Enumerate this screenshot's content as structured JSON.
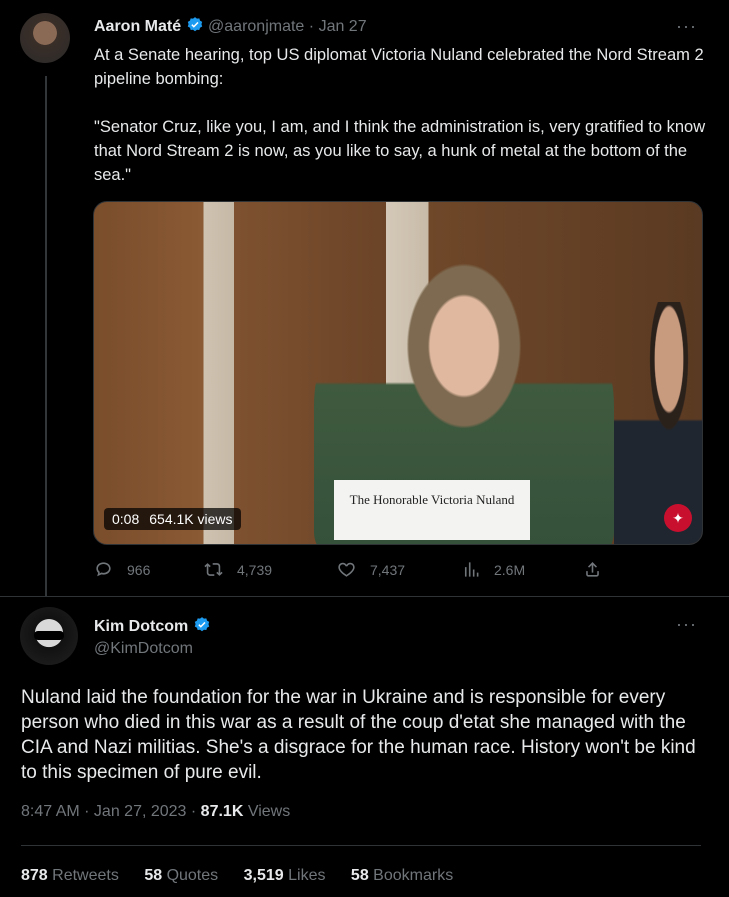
{
  "tweet1": {
    "author": "Aaron Maté",
    "handle": "@aaronjmate",
    "dot": "·",
    "date": "Jan 27",
    "text": "At a Senate hearing, top US diplomat Victoria Nuland celebrated the Nord Stream 2 pipeline bombing:\n\n\"Senator Cruz, like you, I am, and I think the administration is, very gratified to know that Nord Stream 2 is now, as you like to say, a hunk of metal at the bottom of the sea.\"",
    "video": {
      "time": "0:08",
      "views": "654.1K views",
      "placard": "The Honorable Victoria Nuland"
    },
    "actions": {
      "replies": "966",
      "retweets": "4,739",
      "likes": "7,437",
      "views": "2.6M"
    },
    "more": "···"
  },
  "tweet2": {
    "author": "Kim Dotcom",
    "handle": "@KimDotcom",
    "more": "···",
    "text": "Nuland laid the foundation for the war in Ukraine and is responsible for every person who died in this war as a result of the coup d'etat she managed with the CIA and Nazi militias. She's a disgrace for the human race. History won't be kind to this specimen of pure evil.",
    "time": "8:47 AM",
    "date": "Jan 27, 2023",
    "views_count": "87.1K",
    "views_label": "Views",
    "stats": {
      "retweets_count": "878",
      "retweets_label": "Retweets",
      "quotes_count": "58",
      "quotes_label": "Quotes",
      "likes_count": "3,519",
      "likes_label": "Likes",
      "bookmarks_count": "58",
      "bookmarks_label": "Bookmarks"
    }
  },
  "colors": {
    "background": "#000000",
    "text": "#e7e9ea",
    "muted": "#71767b",
    "verified": "#1d9bf0",
    "divider": "#2f3336"
  }
}
